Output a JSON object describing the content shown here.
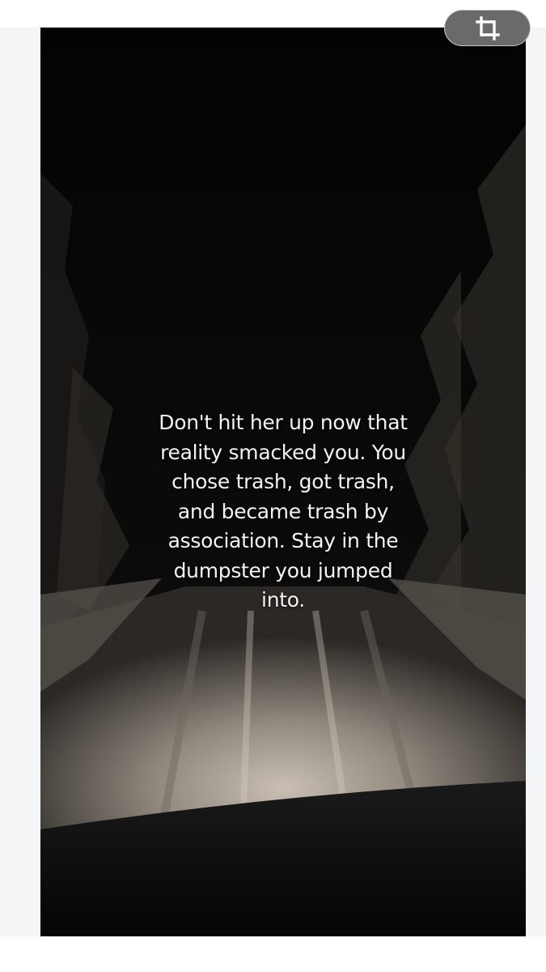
{
  "image": {
    "caption_lines": [
      "Don't hit her up now that",
      "reality smacked you. You",
      "chose trash, got trash,",
      "and became trash by",
      "association. Stay in the",
      "dumpster you jumped",
      "into."
    ]
  },
  "toolbar": {
    "crop_icon": "crop-icon"
  },
  "colors": {
    "page_background": "#f4f5f7",
    "photo_background": "#050505",
    "caption_text": "#f3f3f3",
    "crop_button_bg": "#6a6a6a"
  }
}
